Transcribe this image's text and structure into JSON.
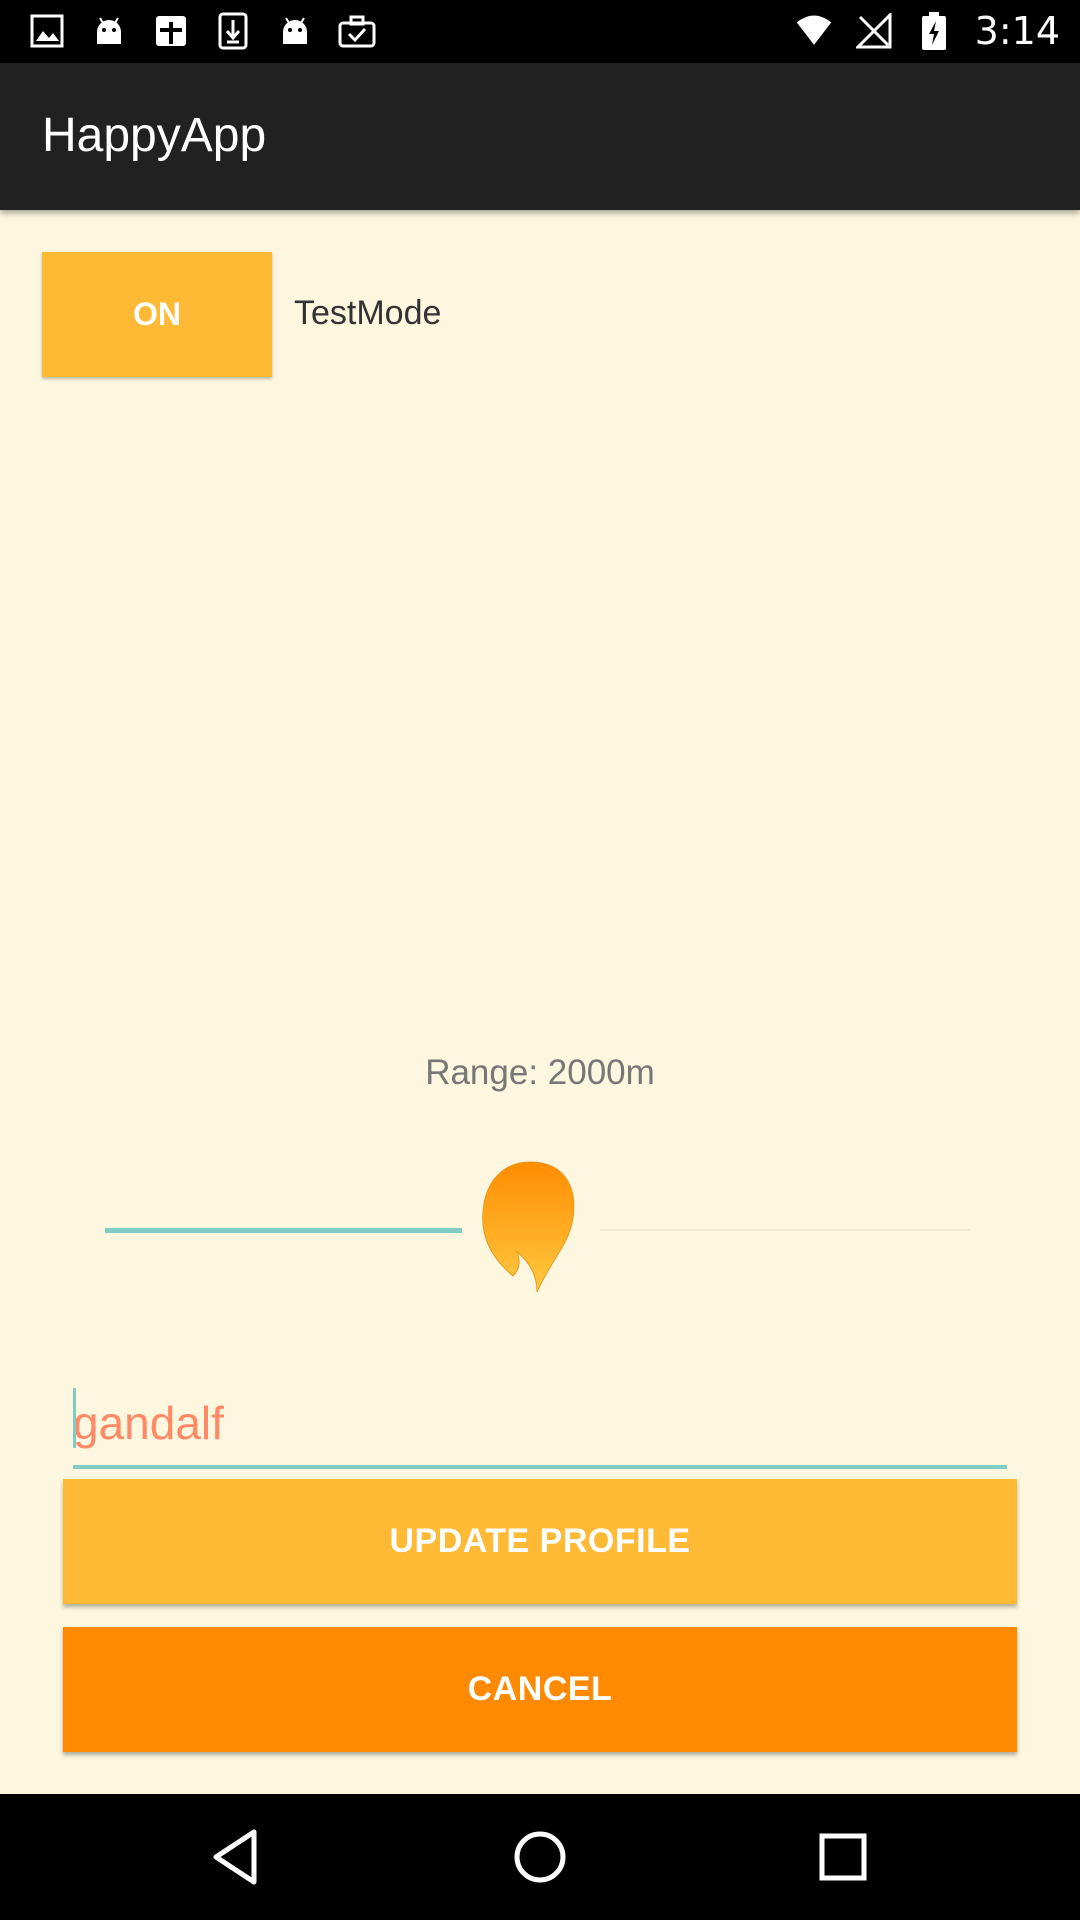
{
  "status_bar": {
    "time": "3:14",
    "left_icons": [
      "gallery-icon",
      "android-icon",
      "calendar-icon",
      "download-icon",
      "android-icon",
      "briefcase-check-icon"
    ],
    "right_icons": [
      "wifi-icon",
      "no-signal-icon",
      "battery-charging-icon"
    ]
  },
  "app_bar": {
    "title": "HappyApp"
  },
  "test_mode": {
    "toggle_label": "ON",
    "label": "TestMode",
    "state": true
  },
  "range": {
    "label": "Range: 2000m",
    "slider_fraction": 0.43
  },
  "profile": {
    "name_value": "gandalf",
    "update_label": "UPDATE PROFILE",
    "cancel_label": "CANCEL"
  },
  "colors": {
    "background": "#fdf7df",
    "app_bar": "#212121",
    "accent_yellow": "#ffba35",
    "accent_orange": "#ff8a00",
    "teal": "#80cbc4",
    "input_text": "#ff8a65"
  },
  "nav_bar": {
    "icons": [
      "back-icon",
      "home-icon",
      "recents-icon"
    ]
  }
}
